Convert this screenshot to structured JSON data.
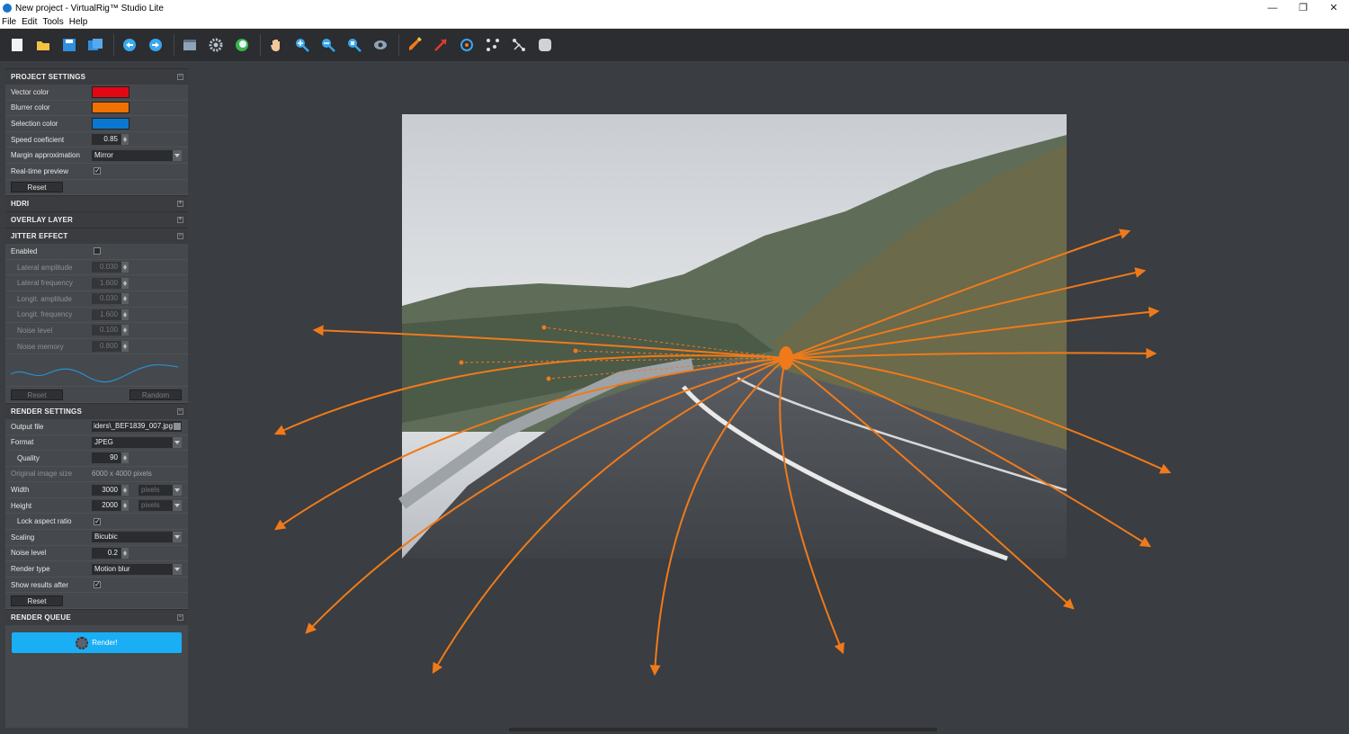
{
  "window": {
    "title": "New project - VirtualRig™ Studio Lite",
    "minimize": "—",
    "restore": "❐",
    "close": "✕"
  },
  "menu": [
    "File",
    "Edit",
    "Tools",
    "Help"
  ],
  "toolbar": [
    "new-document-icon",
    "open-folder-icon",
    "save-icon",
    "save-as-icon",
    "undo-icon",
    "redo-icon",
    "panel-icon",
    "settings-gear-icon",
    "globe-icon",
    "pan-hand-icon",
    "zoom-in-icon",
    "zoom-out-icon",
    "zoom-fit-icon",
    "preview-eye-icon",
    "brush-icon",
    "vector-arrow-icon",
    "target-icon",
    "points-icon",
    "connect-icon",
    "shape-icon"
  ],
  "colors": {
    "vector": "#e30613",
    "blurrer": "#f07000",
    "selection": "#0a78d0",
    "accent": "#1aaef5",
    "arrows": "#f07a1a"
  },
  "project_settings": {
    "title": "PROJECT SETTINGS",
    "vector_color": "Vector color",
    "blurrer_color": "Blurrer color",
    "selection_color": "Selection color",
    "speed_coefficient": "Speed coeficient",
    "speed_value": "0.85",
    "margin_approx": "Margin approximation",
    "margin_value": "Mirror",
    "realtime_preview": "Real-time preview",
    "reset": "Reset"
  },
  "hdri": {
    "title": "HDRI"
  },
  "overlay_layer": {
    "title": "OVERLAY LAYER"
  },
  "jitter": {
    "title": "JITTER EFFECT",
    "enabled": "Enabled",
    "rows": [
      {
        "label": "Lateral amplitude",
        "value": "0.030"
      },
      {
        "label": "Lateral frequency",
        "value": "1.600"
      },
      {
        "label": "Longit. amplitude",
        "value": "0.030"
      },
      {
        "label": "Longit. frequency",
        "value": "1.600"
      },
      {
        "label": "Noise level",
        "value": "0.100"
      },
      {
        "label": "Noise memory",
        "value": "0.800"
      }
    ],
    "reset": "Reset",
    "random": "Random"
  },
  "render_settings": {
    "title": "RENDER SETTINGS",
    "output_file": "Output file",
    "output_value": "iders\\_BEF1839_007.jpg",
    "format": "Format",
    "format_value": "JPEG",
    "quality": "Quality",
    "quality_value": "90",
    "original_size": "Original image size",
    "original_value": "6000 x 4000 pixels",
    "width": "Width",
    "width_value": "3000",
    "height": "Height",
    "height_value": "2000",
    "unit": "pixels",
    "lock_aspect": "Lock aspect ratio",
    "scaling": "Scaling",
    "scaling_value": "Bicubic",
    "noise_level": "Noise level",
    "noise_value": "0.2",
    "render_type": "Render type",
    "render_type_value": "Motion blur",
    "show_results": "Show results after",
    "reset": "Reset"
  },
  "render_queue": {
    "title": "RENDER QUEUE",
    "render": "Render!"
  }
}
